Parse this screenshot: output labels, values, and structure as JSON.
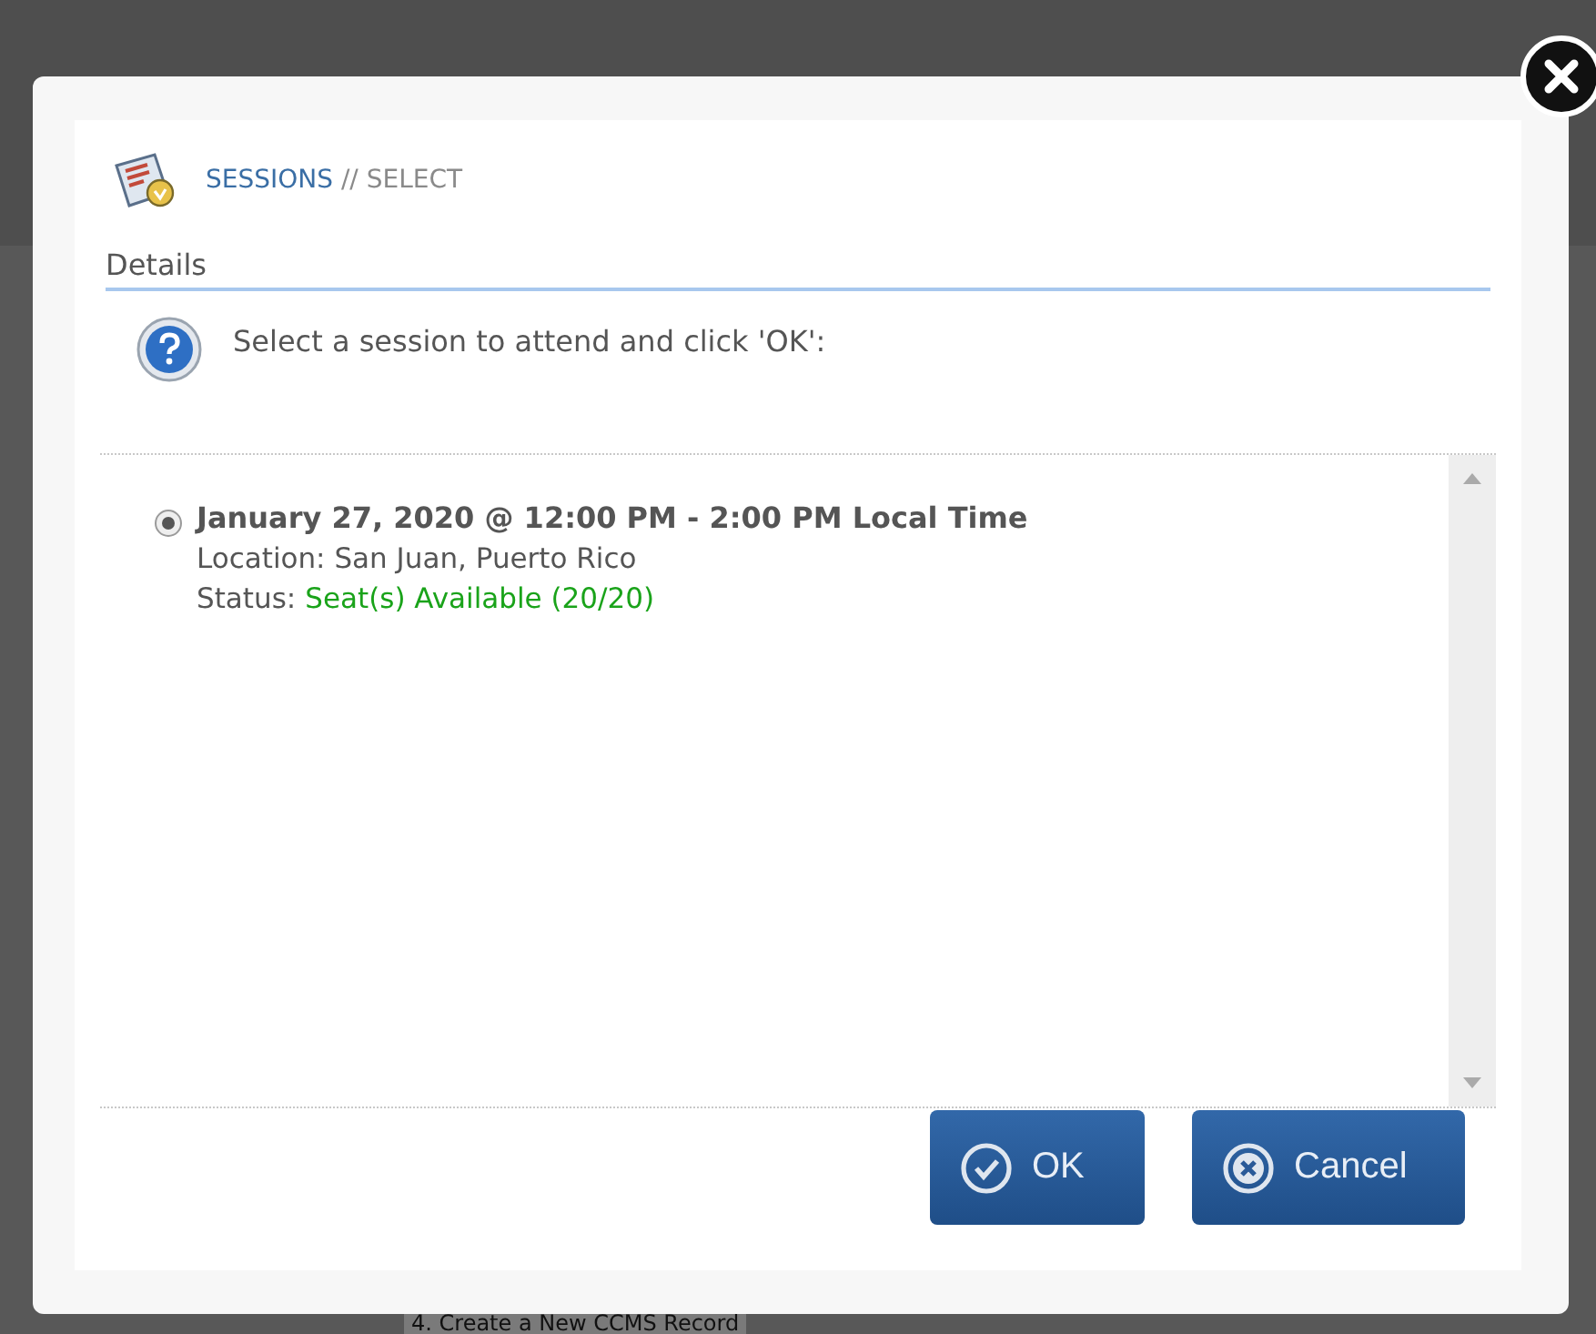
{
  "background": {
    "text": "4. Create a New CCMS Record"
  },
  "breadcrumb": {
    "section": "SESSIONS",
    "separator": "//",
    "page": "SELECT"
  },
  "details": {
    "heading": "Details",
    "instruction": "Select a session to attend and click 'OK':"
  },
  "sessions": [
    {
      "title": "January 27, 2020 @ 12:00 PM - 2:00 PM Local Time",
      "location": "Location: San Juan, Puerto Rico",
      "status_label": "Status:",
      "status": "Seat(s) Available (20/20)",
      "selected": true
    }
  ],
  "buttons": [
    {
      "kind": "ok",
      "label": "OK"
    },
    {
      "kind": "cancel",
      "label": "Cancel"
    }
  ]
}
